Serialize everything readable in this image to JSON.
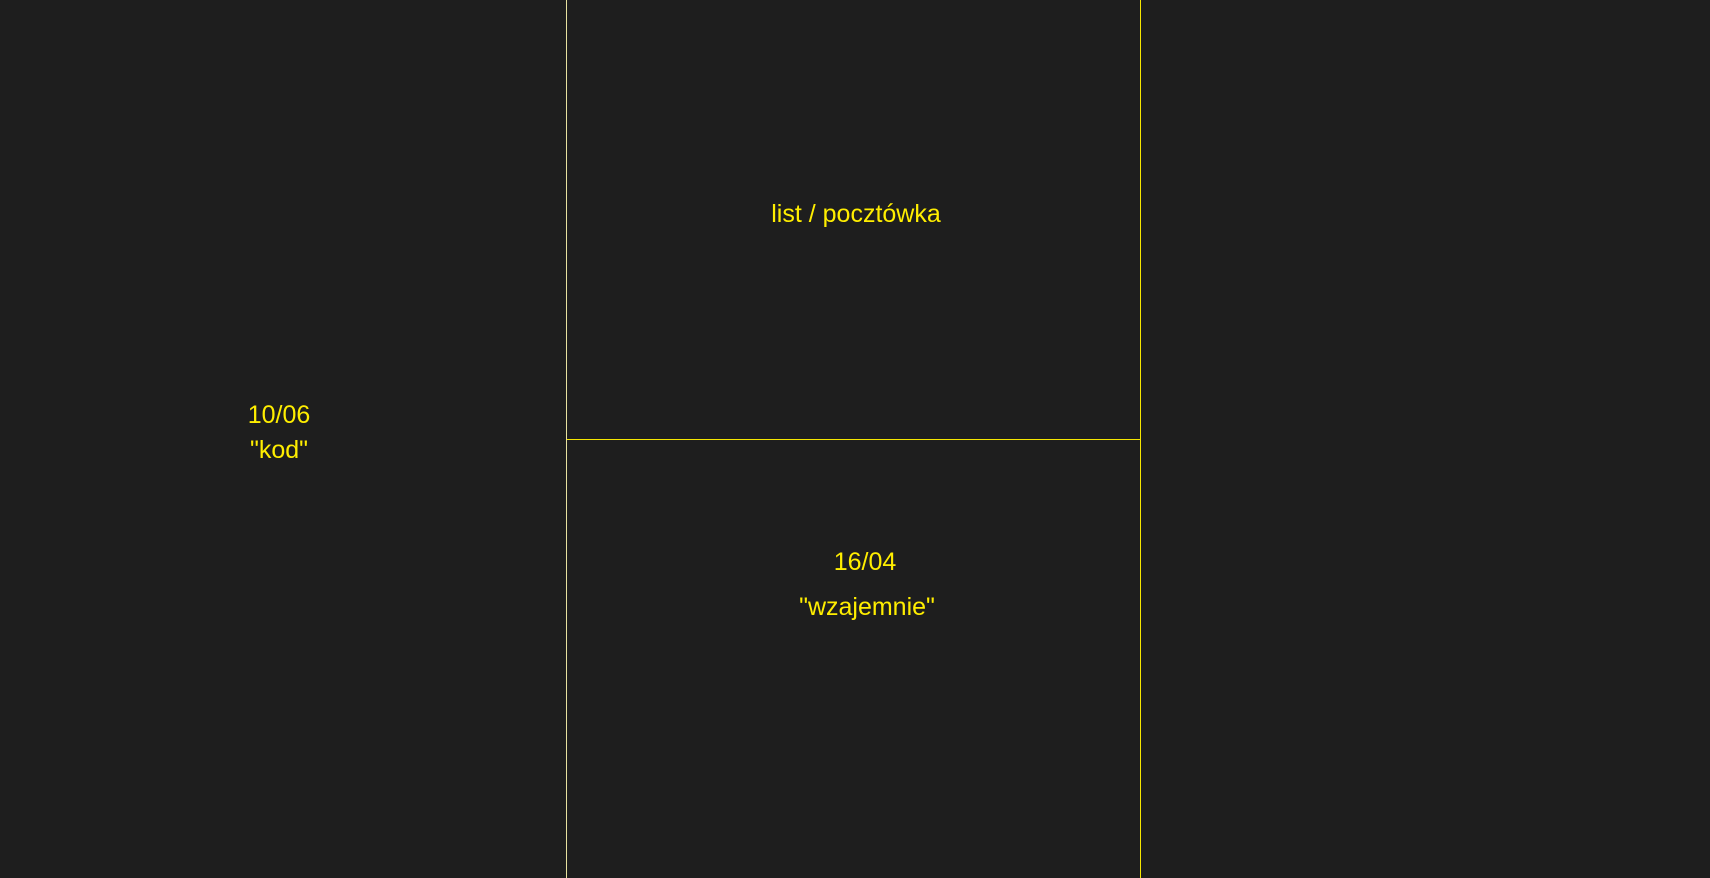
{
  "colors": {
    "background": "#1e1e1e",
    "text": "#ffee00",
    "lines": "#f5e600"
  },
  "left_panel": {
    "date": "10/06",
    "word": "\"kod\""
  },
  "middle_top": {
    "label": "list / pocztówka"
  },
  "middle_bottom": {
    "date": "16/04",
    "word": "\"wzajemnie\""
  }
}
